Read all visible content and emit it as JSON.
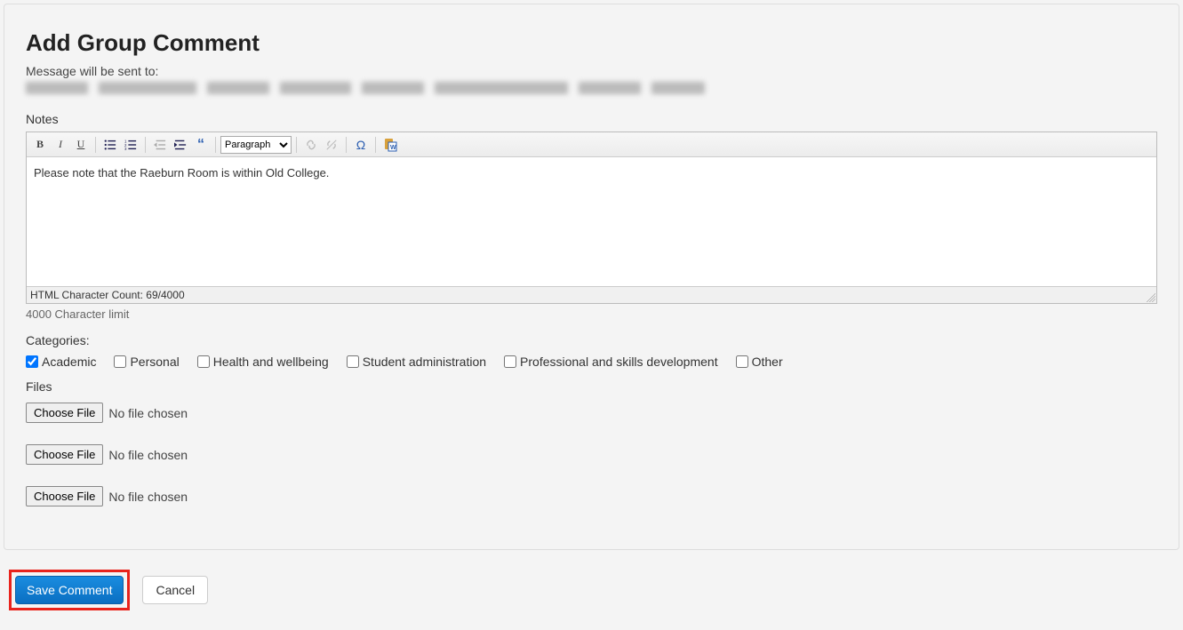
{
  "heading": "Add Group Comment",
  "sentToLabel": "Message will be sent to:",
  "notesLabel": "Notes",
  "toolbar": {
    "formatOptions": [
      "Paragraph"
    ],
    "formatSelected": "Paragraph"
  },
  "editor": {
    "content": "Please note that the Raeburn Room is within Old College.",
    "charCountLabel": "HTML Character Count: 69/4000"
  },
  "charLimitHint": "4000 Character limit",
  "categoriesLabel": "Categories:",
  "categories": [
    {
      "label": "Academic",
      "checked": true
    },
    {
      "label": "Personal",
      "checked": false
    },
    {
      "label": "Health and wellbeing",
      "checked": false
    },
    {
      "label": "Student administration",
      "checked": false
    },
    {
      "label": "Professional and skills development",
      "checked": false
    },
    {
      "label": "Other",
      "checked": false
    }
  ],
  "filesLabel": "Files",
  "fileRows": [
    {
      "buttonLabel": "Choose File",
      "status": "No file chosen"
    },
    {
      "buttonLabel": "Choose File",
      "status": "No file chosen"
    },
    {
      "buttonLabel": "Choose File",
      "status": "No file chosen"
    }
  ],
  "actions": {
    "save": "Save Comment",
    "cancel": "Cancel"
  }
}
